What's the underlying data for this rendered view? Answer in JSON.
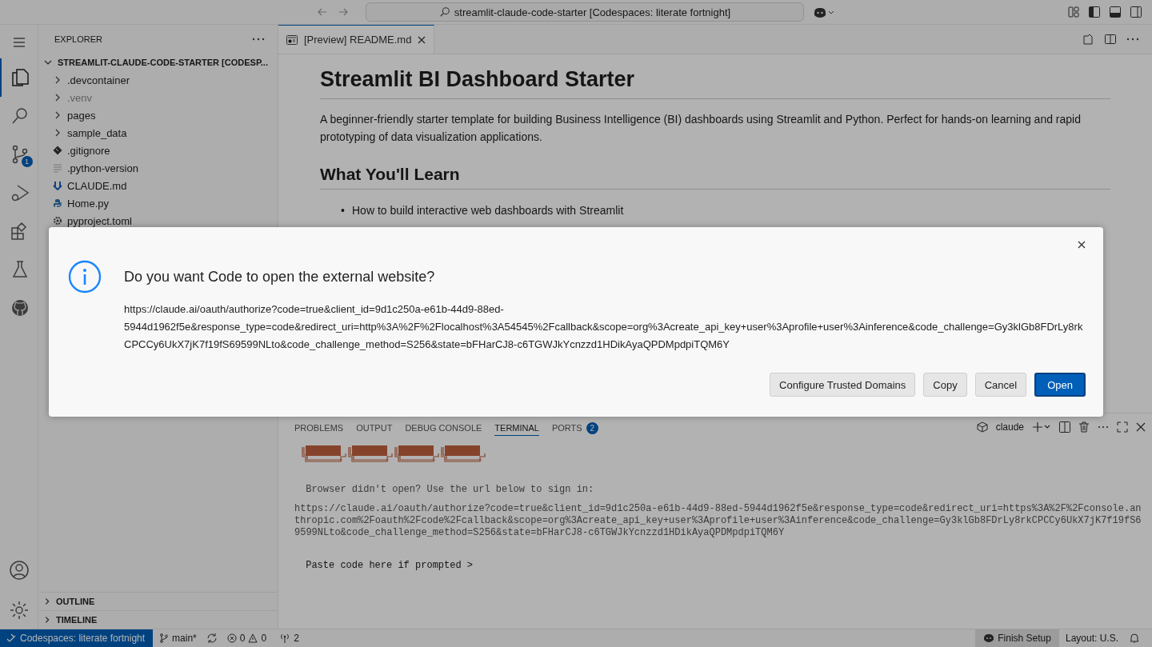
{
  "title_bar": {
    "command_center": "streamlit-claude-code-starter [Codespaces: literate fortnight]"
  },
  "activity_bar": {
    "items": [
      {
        "kind": "explorer",
        "selected": true
      },
      {
        "kind": "search",
        "selected": false
      },
      {
        "kind": "source-control",
        "selected": false,
        "badge": "1"
      },
      {
        "kind": "run-debug",
        "selected": false
      },
      {
        "kind": "extensions",
        "selected": false
      },
      {
        "kind": "testing",
        "selected": false
      },
      {
        "kind": "github",
        "selected": false
      }
    ]
  },
  "sidebar": {
    "title": "EXPLORER",
    "root": {
      "label": "STREAMLIT-CLAUDE-CODE-STARTER [CODESP...",
      "expanded": true
    },
    "items": [
      {
        "label": ".devcontainer",
        "kind": "folder",
        "expanded": false,
        "dimmed": false
      },
      {
        "label": ".venv",
        "kind": "folder",
        "expanded": false,
        "dimmed": true
      },
      {
        "label": "pages",
        "kind": "folder",
        "expanded": false,
        "dimmed": false
      },
      {
        "label": "sample_data",
        "kind": "folder",
        "expanded": false,
        "dimmed": false
      },
      {
        "label": ".gitignore",
        "kind": "git",
        "dimmed": false
      },
      {
        "label": ".python-version",
        "kind": "text",
        "dimmed": false
      },
      {
        "label": "CLAUDE.md",
        "kind": "markdown",
        "dimmed": false
      },
      {
        "label": "Home.py",
        "kind": "python",
        "dimmed": false
      },
      {
        "label": "pyproject.toml",
        "kind": "config",
        "dimmed": false
      }
    ],
    "sections": [
      {
        "label": "OUTLINE",
        "expanded": false
      },
      {
        "label": "TIMELINE",
        "expanded": false
      }
    ]
  },
  "editor": {
    "tabs": [
      {
        "label": "[Preview] README.md",
        "selected": true
      }
    ],
    "preview": {
      "title": "Streamlit BI Dashboard Starter",
      "intro": "A beginner-friendly starter template for building Business Intelligence (BI) dashboards using Streamlit and Python. Perfect for hands-on learning and rapid prototyping of data visualization applications.",
      "heading": "What You'll Learn",
      "bullets": [
        {
          "marker": "•",
          "text": "How to build interactive web dashboards with Streamlit"
        }
      ]
    }
  },
  "dialog": {
    "title": "Do you want Code to open the external website?",
    "url": "https://claude.ai/oauth/authorize?code=true&client_id=9d1c250a-e61b-44d9-88ed-5944d1962f5e&response_type=code&redirect_uri=http%3A%2F%2Flocalhost%3A54545%2Fcallback&scope=org%3Acreate_api_key+user%3Aprofile+user%3Ainference&code_challenge=Gy3klGb8FDrLy8rkCPCCy6UkX7jK7f19fS69599NLto&code_challenge_method=S256&state=bFHarCJ8-c6TGWJkYcnzzd1HDikAyaQPDMpdpiTQM6Y",
    "buttons": [
      {
        "label": "Configure Trusted Domains",
        "kind": "secondary"
      },
      {
        "label": "Copy",
        "kind": "secondary"
      },
      {
        "label": "Cancel",
        "kind": "secondary"
      },
      {
        "label": "Open",
        "kind": "primary"
      }
    ]
  },
  "panel": {
    "tabs": [
      {
        "label": "PROBLEMS",
        "selected": false
      },
      {
        "label": "OUTPUT",
        "selected": false
      },
      {
        "label": "DEBUG CONSOLE",
        "selected": false
      },
      {
        "label": "TERMINAL",
        "selected": true
      },
      {
        "label": "PORTS",
        "selected": false,
        "badge": "2"
      }
    ],
    "terminal_name": "claude",
    "lines": [
      {
        "kind": "art"
      },
      {
        "kind": "text",
        "text": " Browser didn't open? Use the url below to sign in:"
      },
      {
        "kind": "url",
        "text": "https://claude.ai/oauth/authorize?code=true&client_id=9d1c250a-e61b-44d9-88ed-5944d1962f5e&response_type=code&redirect_uri=https%3A%2F%2Fconsole.anthropic.com%2Foauth%2Fcode%2Fcallback&scope=org%3Acreate_api_key+user%3Aprofile+user%3Ainference&code_challenge=Gy3klGb8FDrLy8rkCPCCy6UkX7jK7f19fS69599NLto&code_challenge_method=S256&state=bFHarCJ8-c6TGWJkYcnzzd1HDikAyaQPDMpdpiTQM6Y"
      },
      {
        "kind": "prompt",
        "text": " Paste code here if prompted >"
      }
    ]
  },
  "status_bar": {
    "remote": "Codespaces: literate fortnight",
    "branch": "main*",
    "errors": "0",
    "warnings": "0",
    "ports": "2",
    "finish_setup": "Finish Setup",
    "layout": "Layout: U.S."
  }
}
